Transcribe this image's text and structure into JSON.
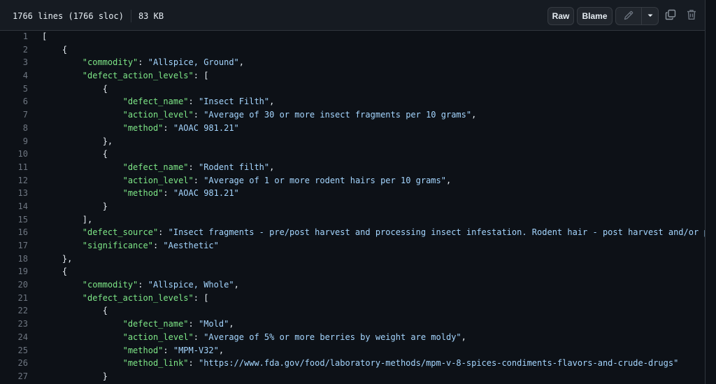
{
  "file_info": {
    "lines": "1766 lines (1766 sloc)",
    "size": "83 KB"
  },
  "toolbar": {
    "raw_label": "Raw",
    "blame_label": "Blame",
    "icons": [
      "pencil-icon",
      "triangle-down-icon",
      "copy-icon",
      "trash-icon"
    ]
  },
  "colors": {
    "background": "#0d1117",
    "header": "#161b22",
    "key": "#7ee787",
    "string": "#a5d6ff",
    "line_number": "#6e7681"
  },
  "code_lines": [
    {
      "n": "1",
      "t": [
        [
          "p",
          "["
        ]
      ]
    },
    {
      "n": "2",
      "t": [
        [
          "p",
          "    {"
        ]
      ]
    },
    {
      "n": "3",
      "t": [
        [
          "p",
          "        "
        ],
        [
          "k",
          "\"commodity\""
        ],
        [
          "p",
          ": "
        ],
        [
          "s",
          "\"Allspice, Ground\""
        ],
        [
          "p",
          ","
        ]
      ]
    },
    {
      "n": "4",
      "t": [
        [
          "p",
          "        "
        ],
        [
          "k",
          "\"defect_action_levels\""
        ],
        [
          "p",
          ": ["
        ]
      ]
    },
    {
      "n": "5",
      "t": [
        [
          "p",
          "            {"
        ]
      ]
    },
    {
      "n": "6",
      "t": [
        [
          "p",
          "                "
        ],
        [
          "k",
          "\"defect_name\""
        ],
        [
          "p",
          ": "
        ],
        [
          "s",
          "\"Insect Filth\""
        ],
        [
          "p",
          ","
        ]
      ]
    },
    {
      "n": "7",
      "t": [
        [
          "p",
          "                "
        ],
        [
          "k",
          "\"action_level\""
        ],
        [
          "p",
          ": "
        ],
        [
          "s",
          "\"Average of 30 or more insect fragments per 10 grams\""
        ],
        [
          "p",
          ","
        ]
      ]
    },
    {
      "n": "8",
      "t": [
        [
          "p",
          "                "
        ],
        [
          "k",
          "\"method\""
        ],
        [
          "p",
          ": "
        ],
        [
          "s",
          "\"AOAC 981.21\""
        ]
      ]
    },
    {
      "n": "9",
      "t": [
        [
          "p",
          "            },"
        ]
      ]
    },
    {
      "n": "10",
      "t": [
        [
          "p",
          "            {"
        ]
      ]
    },
    {
      "n": "11",
      "t": [
        [
          "p",
          "                "
        ],
        [
          "k",
          "\"defect_name\""
        ],
        [
          "p",
          ": "
        ],
        [
          "s",
          "\"Rodent filth\""
        ],
        [
          "p",
          ","
        ]
      ]
    },
    {
      "n": "12",
      "t": [
        [
          "p",
          "                "
        ],
        [
          "k",
          "\"action_level\""
        ],
        [
          "p",
          ": "
        ],
        [
          "s",
          "\"Average of 1 or more rodent hairs per 10 grams\""
        ],
        [
          "p",
          ","
        ]
      ]
    },
    {
      "n": "13",
      "t": [
        [
          "p",
          "                "
        ],
        [
          "k",
          "\"method\""
        ],
        [
          "p",
          ": "
        ],
        [
          "s",
          "\"AOAC 981.21\""
        ]
      ]
    },
    {
      "n": "14",
      "t": [
        [
          "p",
          "            }"
        ]
      ]
    },
    {
      "n": "15",
      "t": [
        [
          "p",
          "        ],"
        ]
      ]
    },
    {
      "n": "16",
      "t": [
        [
          "p",
          "        "
        ],
        [
          "k",
          "\"defect_source\""
        ],
        [
          "p",
          ": "
        ],
        [
          "s",
          "\"Insect fragments - pre/post harvest and processing insect infestation. Rodent hair - post harvest and/or processing"
        ]
      ]
    },
    {
      "n": "17",
      "t": [
        [
          "p",
          "        "
        ],
        [
          "k",
          "\"significance\""
        ],
        [
          "p",
          ": "
        ],
        [
          "s",
          "\"Aesthetic\""
        ]
      ]
    },
    {
      "n": "18",
      "t": [
        [
          "p",
          "    },"
        ]
      ]
    },
    {
      "n": "19",
      "t": [
        [
          "p",
          "    {"
        ]
      ]
    },
    {
      "n": "20",
      "t": [
        [
          "p",
          "        "
        ],
        [
          "k",
          "\"commodity\""
        ],
        [
          "p",
          ": "
        ],
        [
          "s",
          "\"Allspice, Whole\""
        ],
        [
          "p",
          ","
        ]
      ]
    },
    {
      "n": "21",
      "t": [
        [
          "p",
          "        "
        ],
        [
          "k",
          "\"defect_action_levels\""
        ],
        [
          "p",
          ": ["
        ]
      ]
    },
    {
      "n": "22",
      "t": [
        [
          "p",
          "            {"
        ]
      ]
    },
    {
      "n": "23",
      "t": [
        [
          "p",
          "                "
        ],
        [
          "k",
          "\"defect_name\""
        ],
        [
          "p",
          ": "
        ],
        [
          "s",
          "\"Mold\""
        ],
        [
          "p",
          ","
        ]
      ]
    },
    {
      "n": "24",
      "t": [
        [
          "p",
          "                "
        ],
        [
          "k",
          "\"action_level\""
        ],
        [
          "p",
          ": "
        ],
        [
          "s",
          "\"Average of 5% or more berries by weight are moldy\""
        ],
        [
          "p",
          ","
        ]
      ]
    },
    {
      "n": "25",
      "t": [
        [
          "p",
          "                "
        ],
        [
          "k",
          "\"method\""
        ],
        [
          "p",
          ": "
        ],
        [
          "s",
          "\"MPM-V32\""
        ],
        [
          "p",
          ","
        ]
      ]
    },
    {
      "n": "26",
      "t": [
        [
          "p",
          "                "
        ],
        [
          "k",
          "\"method_link\""
        ],
        [
          "p",
          ": "
        ],
        [
          "s",
          "\"https://www.fda.gov/food/laboratory-methods/mpm-v-8-spices-condiments-flavors-and-crude-drugs\""
        ]
      ]
    },
    {
      "n": "27",
      "t": [
        [
          "p",
          "            }"
        ]
      ]
    }
  ]
}
